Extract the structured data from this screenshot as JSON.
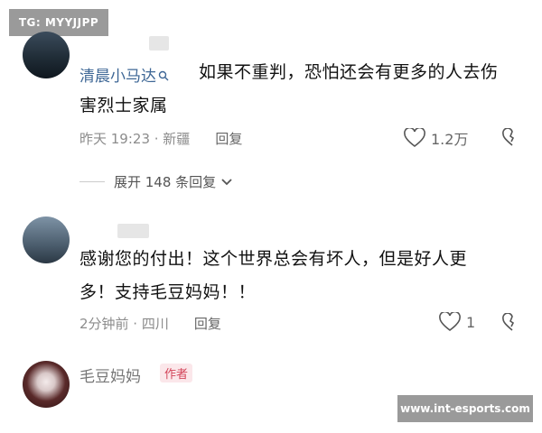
{
  "watermarks": {
    "top_left": "TG: MYYJJPP",
    "bottom_right": "www.int-esports.com"
  },
  "comments": [
    {
      "user": "清晨小马达",
      "text_line1": "如果不重判，恐怕还会有更多的人去伤",
      "text_line2": "害烈士家属",
      "time": "昨天 19:23 · 新疆",
      "reply": "回复",
      "likes": "1.2万",
      "expand": "展开 148 条回复"
    },
    {
      "text_line1": "感谢您的付出！这个世界总会有坏人，但是好人更",
      "text_line2": "多！支持毛豆妈妈！！",
      "time": "2分钟前 · 四川",
      "reply": "回复",
      "likes": "1"
    },
    {
      "user": "毛豆妈妈",
      "badge": "作者"
    }
  ],
  "colors": {
    "username": "#3e6796",
    "badge_text": "#d3455a",
    "badge_bg": "#fbe7ea"
  }
}
